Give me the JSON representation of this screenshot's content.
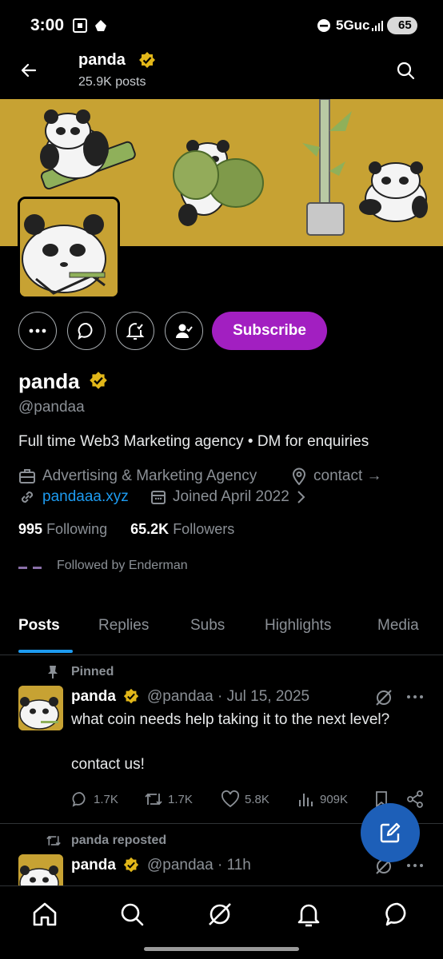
{
  "status_bar": {
    "time": "3:00",
    "network": "5Guc",
    "battery": "65"
  },
  "header": {
    "name": "panda",
    "posts": "25.9K posts"
  },
  "profile": {
    "name": "panda",
    "handle": "@pandaa",
    "bio": "Full time Web3 Marketing agency • DM for enquiries",
    "category": "Advertising & Marketing Agency",
    "contact": "contact →",
    "website": "pandaaa.xyz",
    "joined": "Joined April 2022",
    "following_count": "995",
    "following_label": "Following",
    "followers_count": "65.2K",
    "followers_label": "Followers",
    "followed_by": "Followed by Enderman",
    "subscribe_label": "Subscribe"
  },
  "tabs": [
    {
      "label": "Posts"
    },
    {
      "label": "Replies"
    },
    {
      "label": "Subs"
    },
    {
      "label": "Highlights"
    },
    {
      "label": "Media"
    }
  ],
  "posts": [
    {
      "context": "Pinned",
      "author": "panda",
      "handle_date": "@pandaa · Jul 15, 2025",
      "text_line1": "what coin needs help taking it to the next level?",
      "text_line2": "contact us!",
      "replies": "1.7K",
      "reposts": "1.7K",
      "likes": "5.8K",
      "views": "909K"
    },
    {
      "context": "panda reposted",
      "author": "panda",
      "handle_date": "@pandaa · 11h"
    }
  ],
  "colors": {
    "accent": "#1d9bf0",
    "subscribe": "#a21fc1",
    "banner": "#c7a233",
    "verified": "#e2b719"
  }
}
